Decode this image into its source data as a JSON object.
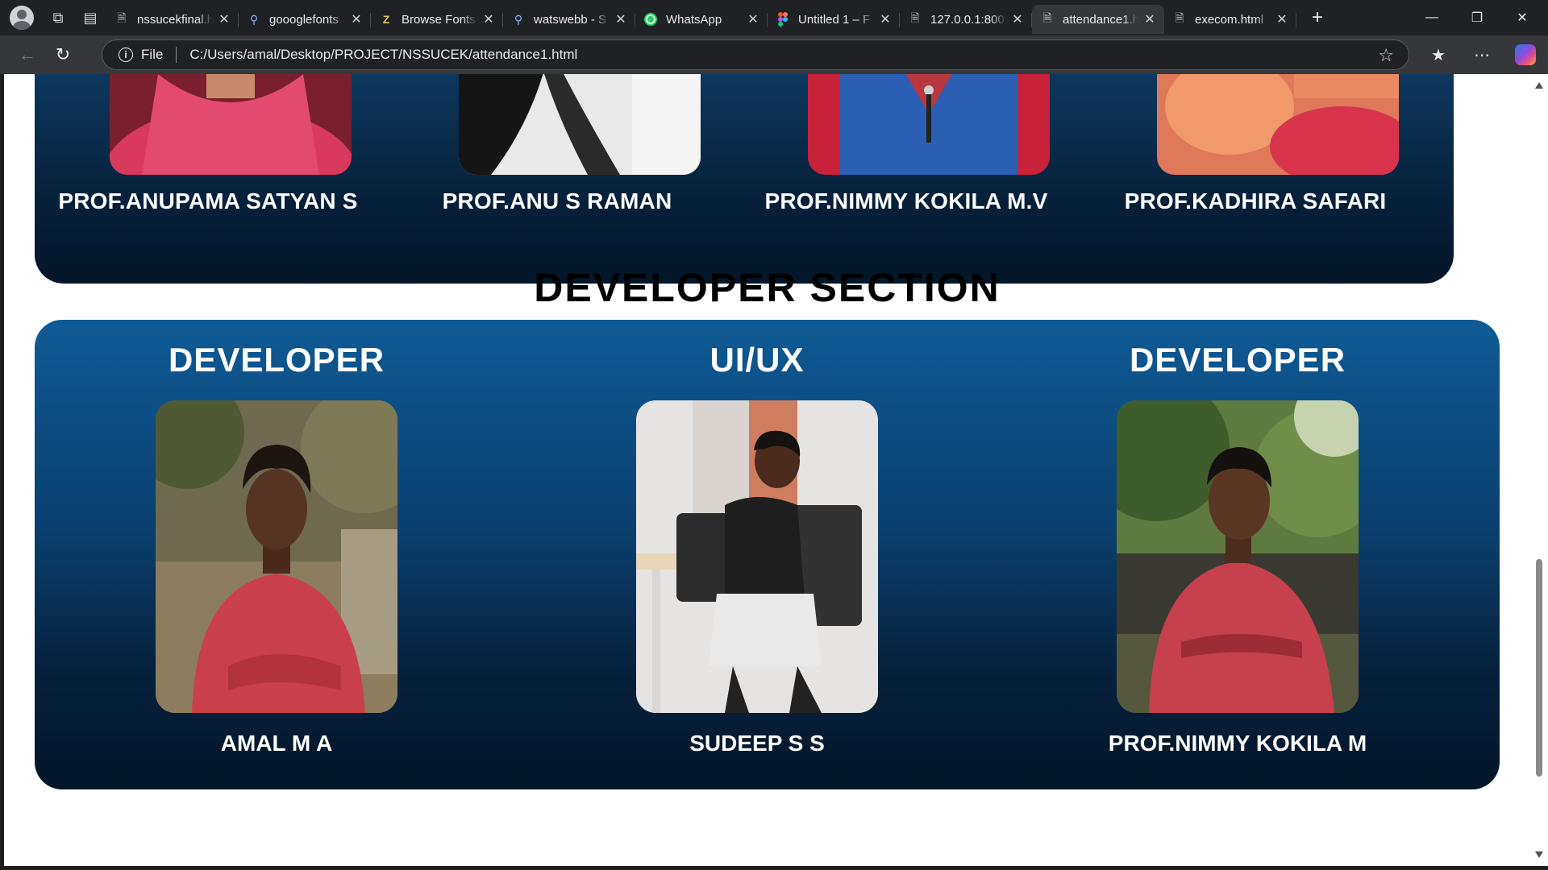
{
  "browser": {
    "tabs": [
      {
        "title": "nssucekfinal.h",
        "icon": "document-icon",
        "active": false
      },
      {
        "title": "goooglefonts",
        "icon": "search-icon",
        "active": false
      },
      {
        "title": "Browse Fonts",
        "icon": "fonts-icon",
        "active": false
      },
      {
        "title": "watswebb - S",
        "icon": "search-icon",
        "active": false
      },
      {
        "title": "WhatsApp",
        "icon": "whatsapp-icon",
        "active": false
      },
      {
        "title": "Untitled 1 – F",
        "icon": "figma-icon",
        "active": false
      },
      {
        "title": "127.0.0.1:800",
        "icon": "document-icon",
        "active": false
      },
      {
        "title": "attendance1.h",
        "icon": "document-icon",
        "active": true
      },
      {
        "title": "execom.html",
        "icon": "document-icon",
        "active": false
      }
    ],
    "address_scheme": "File",
    "address_url": "C:/Users/amal/Desktop/PROJECT/NSSUCEK/attendance1.html"
  },
  "faculty": [
    {
      "name": "PROF.ANUPAMA SATYAN S"
    },
    {
      "name": "PROF.ANU S RAMAN"
    },
    {
      "name": "PROF.NIMMY KOKILA M.V"
    },
    {
      "name": "PROF.KADHIRA SAFARI"
    }
  ],
  "developer_section": {
    "title": "DEVELOPER SECTION",
    "members": [
      {
        "role": "DEVELOPER",
        "name": "AMAL M A"
      },
      {
        "role": "UI/UX",
        "name": "SUDEEP S S"
      },
      {
        "role": "DEVELOPER",
        "name": "PROF.NIMMY KOKILA M"
      }
    ]
  },
  "colors": {
    "block_top": "#0f5a95",
    "block_bottom": "#041628",
    "faculty_block": "#061e36",
    "page_bg": "#ffffff",
    "chrome_dark": "#202124"
  }
}
